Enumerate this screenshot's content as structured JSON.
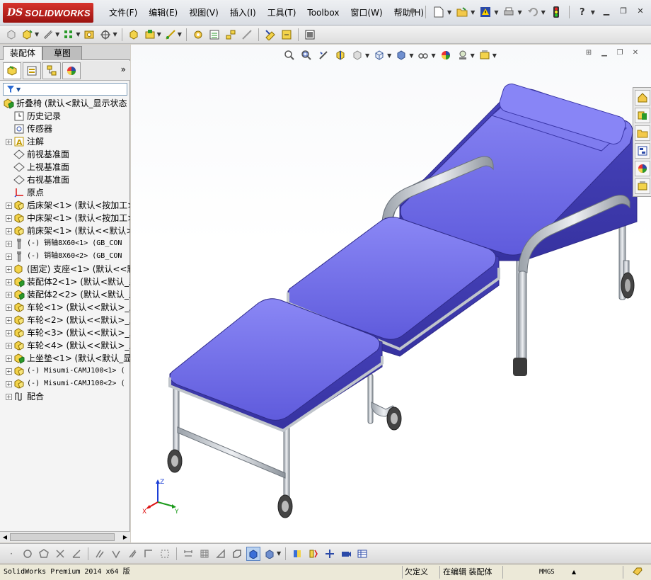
{
  "app": {
    "logo_ds": "DS",
    "logo_name": "SOLIDWORKS",
    "menus": [
      "文件(F)",
      "编辑(E)",
      "视图(V)",
      "插入(I)",
      "工具(T)",
      "Toolbox",
      "窗口(W)",
      "帮助(H)"
    ],
    "title_tools": [
      "pin-icon",
      "new-document-icon",
      "open-icon",
      "warning-icon",
      "print-icon",
      "undo-icon",
      "traffic-light-icon",
      "help-icon"
    ],
    "window_controls": [
      "minimize",
      "restore",
      "close"
    ]
  },
  "panel": {
    "tabs": [
      "装配体",
      "草图"
    ],
    "manager_tabs": [
      "feature-manager-icon",
      "property-manager-icon",
      "configuration-manager-icon",
      "display-manager-icon"
    ],
    "more": "»",
    "filter_icon": "filter-icon"
  },
  "tree": [
    {
      "label": "折叠椅  (默认<默认_显示状态",
      "icon": "assembly-icon",
      "expander": "",
      "level": 0
    },
    {
      "label": "历史记录",
      "icon": "history-icon",
      "expander": "",
      "level": 1
    },
    {
      "label": "传感器",
      "icon": "sensor-icon",
      "expander": "",
      "level": 1
    },
    {
      "label": "注解",
      "icon": "annotation-icon",
      "expander": "+",
      "level": 1
    },
    {
      "label": "前视基准面",
      "icon": "plane-icon",
      "expander": "",
      "level": 1
    },
    {
      "label": "上视基准面",
      "icon": "plane-icon",
      "expander": "",
      "level": 1
    },
    {
      "label": "右视基准面",
      "icon": "plane-icon",
      "expander": "",
      "level": 1
    },
    {
      "label": "原点",
      "icon": "origin-icon",
      "expander": "",
      "level": 1
    },
    {
      "label": "后床架<1>  (默认<按加工>",
      "icon": "subassembly-icon",
      "expander": "+",
      "level": 1
    },
    {
      "label": "中床架<1>  (默认<按加工>",
      "icon": "subassembly-icon",
      "expander": "+",
      "level": 1
    },
    {
      "label": "前床架<1>  (默认<<默认>_",
      "icon": "subassembly-icon",
      "expander": "+",
      "level": 1
    },
    {
      "label": "(-) 销轴8X60<1>  (GB_CON",
      "icon": "pin-part-icon",
      "expander": "+",
      "level": 1,
      "mono": true
    },
    {
      "label": "(-) 销轴8X60<2>  (GB_CON",
      "icon": "pin-part-icon",
      "expander": "+",
      "level": 1,
      "mono": true
    },
    {
      "label": "(固定) 支座<1>  (默认<<默",
      "icon": "part-icon",
      "expander": "+",
      "level": 1
    },
    {
      "label": "装配体2<1>  (默认<默认_显",
      "icon": "assembly-icon",
      "expander": "+",
      "level": 1
    },
    {
      "label": "装配体2<2>  (默认<默认_显",
      "icon": "assembly-icon",
      "expander": "+",
      "level": 1
    },
    {
      "label": "车轮<1>  (默认<<默认>_显",
      "icon": "subassembly-icon",
      "expander": "+",
      "level": 1
    },
    {
      "label": "车轮<2>  (默认<<默认>_显",
      "icon": "subassembly-icon",
      "expander": "+",
      "level": 1
    },
    {
      "label": "车轮<3>  (默认<<默认>_显",
      "icon": "subassembly-icon",
      "expander": "+",
      "level": 1
    },
    {
      "label": "车轮<4>  (默认<<默认>_显",
      "icon": "subassembly-icon",
      "expander": "+",
      "level": 1
    },
    {
      "label": "上坐垫<1>  (默认<默认_显",
      "icon": "assembly-icon",
      "expander": "+",
      "level": 1
    },
    {
      "label": "(-) Misumi-CAMJ100<1>  (",
      "icon": "subassembly-icon",
      "expander": "+",
      "level": 1,
      "mono": true
    },
    {
      "label": "(-) Misumi-CAMJ100<2>  (",
      "icon": "subassembly-icon",
      "expander": "+",
      "level": 1,
      "mono": true
    },
    {
      "label": "配合",
      "icon": "mates-icon",
      "expander": "+",
      "level": 1
    }
  ],
  "graphics": {
    "view_tools": [
      "zoom-to-fit-icon",
      "zoom-to-area-icon",
      "previous-view-icon",
      "section-view-icon",
      "dynamic-annotation-icon",
      "view-orientation-icon",
      "display-style-icon",
      "hide-show-icon",
      "edit-appearance-icon",
      "apply-scene-icon",
      "view-settings-icon"
    ],
    "task_pane": [
      "home-icon",
      "design-library-icon",
      "file-explorer-icon",
      "view-palette-icon",
      "appearances-icon",
      "custom-properties-icon"
    ],
    "triad": {
      "x": "X",
      "y": "Y",
      "z": "Z"
    },
    "colors": {
      "cushion": "#6b67e6",
      "cushion_top": "#7d7af0",
      "frame": "#c8cdd3",
      "frame_dark": "#8c939b",
      "wheel": "#505050"
    }
  },
  "bottom_tools": [
    "point-icon",
    "circle-icon",
    "polygon-icon",
    "trim-icon",
    "line-icon",
    "fillet-icon",
    "mirror-icon",
    "slash-icon",
    "corner-icon",
    "dotted-box-icon",
    "dimension-icon",
    "grid-icon",
    "triangle-icon",
    "box-icon",
    "shaded-cube-icon",
    "display-cube-icon",
    "dropdown",
    "section-icon",
    "mate-icon",
    "move-icon",
    "camera-icon",
    "table-icon"
  ],
  "status": {
    "version": "SolidWorks Premium 2014 x64 版",
    "definition": "欠定义",
    "editing": "在编辑 装配体",
    "units": "MMGS",
    "units_arrow": "▲"
  }
}
